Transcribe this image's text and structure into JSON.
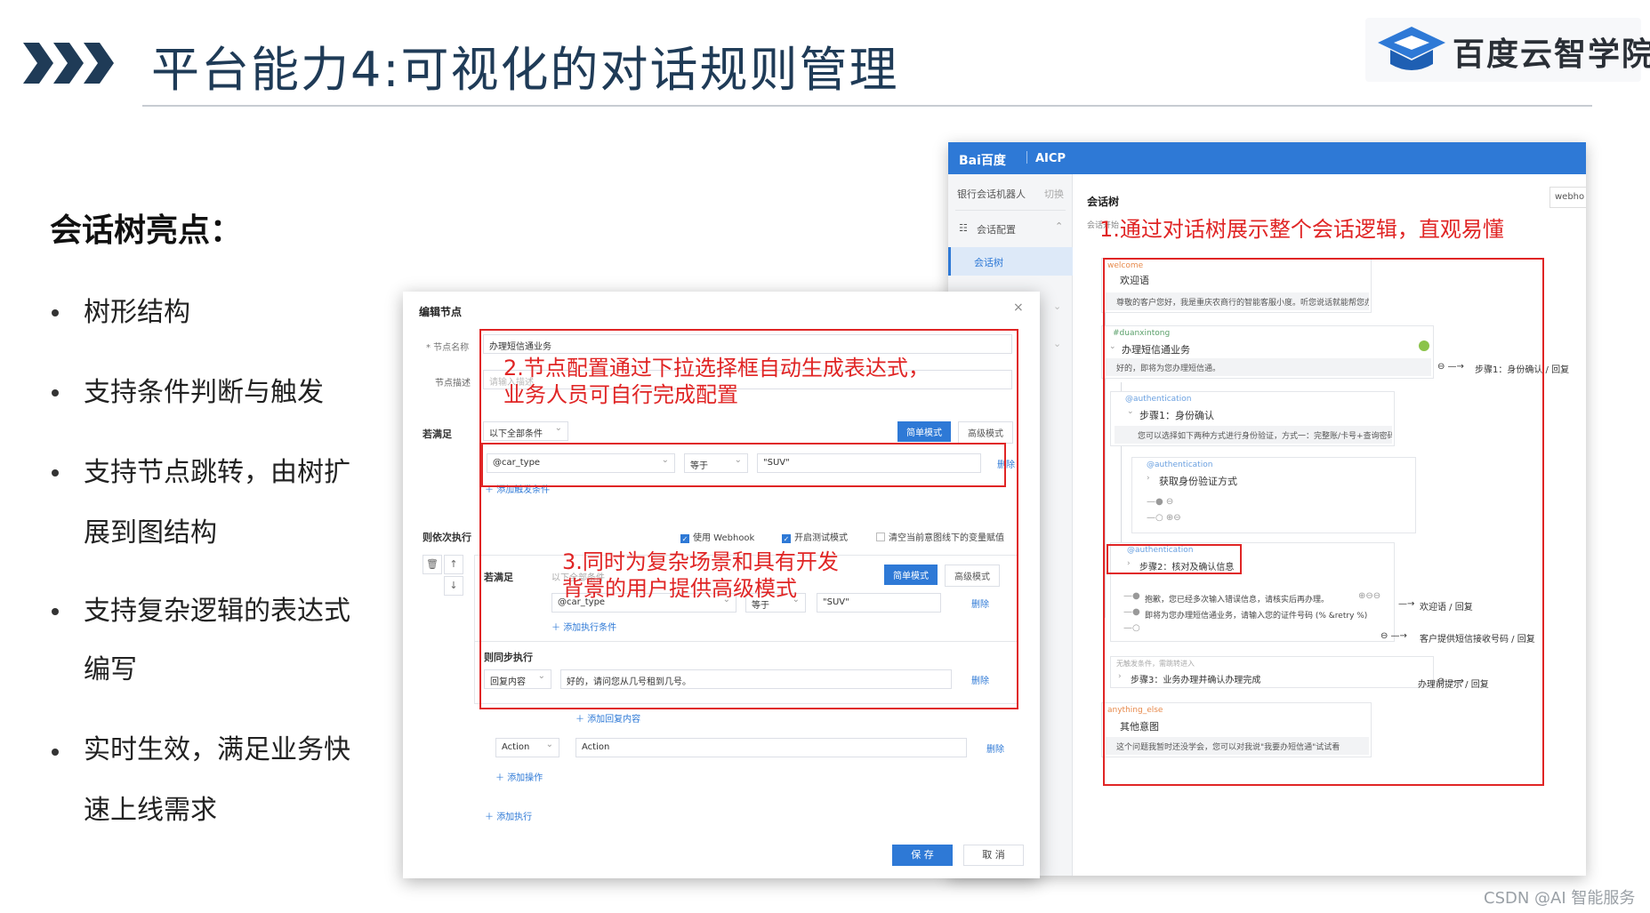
{
  "slide": {
    "title": "平台能力4:可视化的对话规则管理",
    "logo_text": "百度云智学院",
    "highlights_heading": "会话树亮点：",
    "bullets": [
      {
        "line1": "树形结构",
        "line2": ""
      },
      {
        "line1": "支持条件判断与触发",
        "line2": ""
      },
      {
        "line1": "支持节点跳转，由树扩",
        "line2": "展到图结构"
      },
      {
        "line1": "支持复杂逻辑的表达式",
        "line2": "编写"
      },
      {
        "line1": "实时生效，满足业务快",
        "line2": "速上线需求"
      }
    ],
    "footer": "CSDN @AI 智能服务"
  },
  "app": {
    "brand": "Bai百度",
    "product": "AICP",
    "sidebar": {
      "bot_name": "银行会话机器人",
      "switch": "切换",
      "section": "会话配置",
      "active_item": "会话树"
    },
    "tree_title": "会话树",
    "search_value": "webho",
    "start_label": "会话开始",
    "nodes": [
      {
        "tag": "welcome",
        "name": "欢迎语",
        "desc": "尊敬的客户您好，我是重庆农商行的智能客服小度。听您说话就能帮您办..."
      },
      {
        "tag": "#duanxintong",
        "name": "办理短信通业务",
        "desc": "好的，即将为您办理短信通。"
      },
      {
        "tag": "@authentication",
        "name": "步骤1：身份确认",
        "desc": "您可以选择如下两种方式进行身份验证，方式一：完整账/卡号+查询密码..."
      },
      {
        "tag": "@authentication",
        "name": "获取身份验证方式",
        "desc": ""
      },
      {
        "tag": "@authentication",
        "name": "步骤2：核对及确认信息",
        "desc": ""
      },
      {
        "tag": "无触发条件，需跳转进入",
        "name": "步骤3：业务办理并确认办理完成",
        "desc": ""
      },
      {
        "tag": "anything_else",
        "name": "其他意图",
        "desc": "这个问题我暂时还没学会，您可以对我说\"我要办短信通\"试试看"
      }
    ],
    "step2_lines": [
      "抱歉，您已经多次输入错误信息，请核实后再办理。",
      "即将为您办理短信通业务，请输入您的证件号码  (% &retry %)"
    ],
    "flow_labels": [
      "步骤1：身份确认 / 回复",
      "欢迎语 / 回复",
      "客户提供短信接收号码 / 回复",
      "办理前提示 / 回复"
    ]
  },
  "dialog": {
    "title": "编辑节点",
    "close": "×",
    "name_label": "* 节点名称",
    "name_value": "办理短信通业务",
    "desc_label": "节点描述",
    "desc_placeholder": "请输入描述",
    "if_label": "若满足",
    "condition_scope": "以下全部条件",
    "mode_simple": "简单模式",
    "mode_advanced": "高级模式",
    "cond_var": "@car_type",
    "cond_op": "等于",
    "cond_value": "\"SUV\"",
    "delete": "删除",
    "add_trigger": "添加触发条件",
    "then_label": "则依次执行",
    "chk_webhook": "使用 Webhook",
    "chk_test": "开启测试模式",
    "chk_clear": "清空当前意图线下的变量赋值",
    "inner_if": "若满足",
    "inner_scope": "以下全部条件",
    "add_exec_cond": "添加执行条件",
    "sync_label": "则同步执行",
    "reply_type": "回复内容",
    "reply_value": "好的，请问您从几号租到几号。",
    "add_reply": "添加回复内容",
    "action_type": "Action",
    "action_value": "Action",
    "add_action": "添加操作",
    "add_exec": "添加执行",
    "save": "保 存",
    "cancel": "取 消"
  },
  "annotations": {
    "note1": "1.通过对话树展示整个会话逻辑，直观易懂",
    "note2_line1": "2.节点配置通过下拉选择框自动生成表达式，",
    "note2_line2": "业务人员可自行完成配置",
    "note3_line1": "3.同时为复杂场景和具有开发",
    "note3_line2": "背景的用户提供高级模式"
  }
}
